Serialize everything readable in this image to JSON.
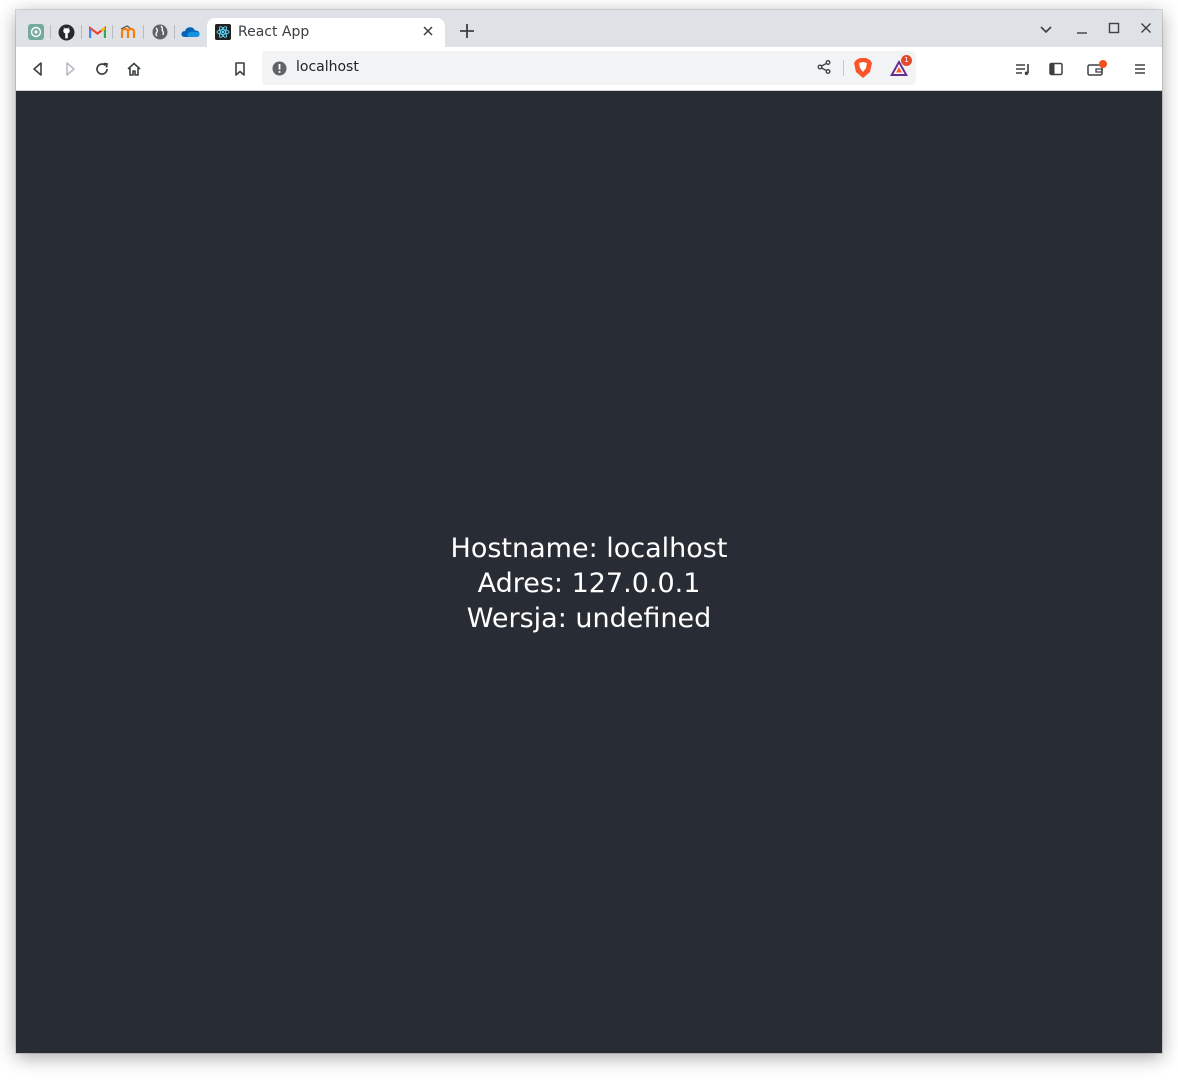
{
  "browser": {
    "pinned_tabs": [
      {
        "icon": "chatgpt-icon",
        "color": "#74aa9c"
      },
      {
        "icon": "github-icon",
        "color": "#24292f"
      },
      {
        "icon": "gmail-icon",
        "color": "#ea4335"
      },
      {
        "icon": "moodle-icon",
        "color": "#f98012"
      },
      {
        "icon": "globe-icon",
        "color": "#5f6368"
      },
      {
        "icon": "onedrive-icon",
        "color": "#0364b8"
      }
    ],
    "active_tab": {
      "title": "React App",
      "icon": "react-icon"
    },
    "address_bar": {
      "url": "localhost"
    },
    "notification_badge": "1"
  },
  "page": {
    "hostname_line": "Hostname: localhost",
    "address_line": "Adres: 127.0.0.1",
    "version_line": "Wersja: undefined",
    "background_color": "#282c34"
  }
}
